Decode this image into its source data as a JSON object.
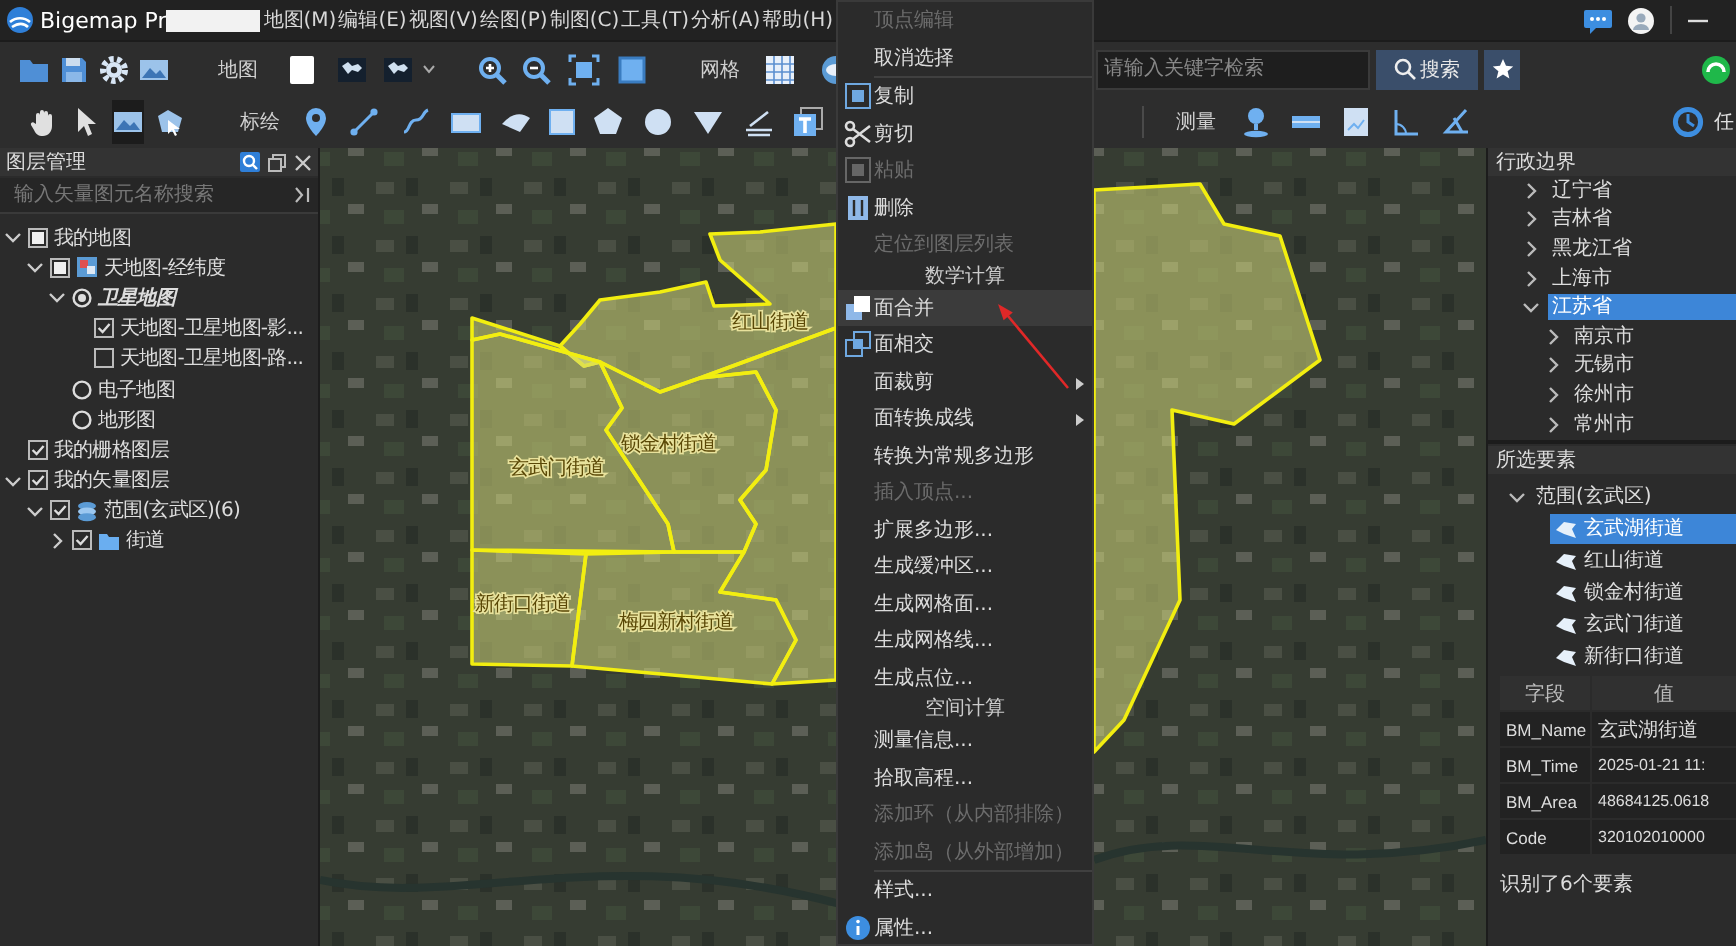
{
  "title_bar": {
    "app_name": "Bigemap Pr",
    "menus": [
      "地图(M)",
      "编辑(E)",
      "视图(V)",
      "绘图(P)",
      "制图(C)",
      "工具(T)",
      "分析(A)",
      "帮助(H)"
    ]
  },
  "toolbar": {
    "map_label": "地图",
    "grid_label": "网格",
    "search": {
      "placeholder": "请输入关键字检索"
    },
    "search_button": "搜索",
    "plot_label": "标绘",
    "measure_label": "测量",
    "task_label": "任"
  },
  "layer_panel": {
    "title": "图层管理",
    "search": {
      "placeholder": "输入矢量图元名称搜索"
    },
    "tree": [
      {
        "kind": "checkbox",
        "label": "我的地图",
        "checked": false,
        "indeterminate": true,
        "expanded": true,
        "children": [
          {
            "kind": "basemap",
            "label": "天地图-经纬度",
            "checked": false,
            "indeterminate": true,
            "expanded": true,
            "children": [
              {
                "kind": "radio",
                "label": "卫星地图",
                "selected": true,
                "expanded": true,
                "children": [
                  {
                    "kind": "checkbox",
                    "label": "天地图-卫星地图-影...",
                    "checked": true,
                    "indeterminate": false
                  },
                  {
                    "kind": "checkbox",
                    "label": "天地图-卫星地图-路...",
                    "checked": false,
                    "indeterminate": false
                  }
                ]
              },
              {
                "kind": "radio",
                "label": "电子地图",
                "selected": false
              },
              {
                "kind": "radio",
                "label": "地形图",
                "selected": false
              }
            ]
          }
        ]
      },
      {
        "kind": "checkbox",
        "label": "我的栅格图层",
        "checked": true,
        "indeterminate": false
      },
      {
        "kind": "checkbox",
        "label": "我的矢量图层",
        "checked": true,
        "indeterminate": false,
        "expanded": true,
        "children": [
          {
            "kind": "vector",
            "label": "范围(玄武区)(6)",
            "checked": true,
            "indeterminate": false,
            "expanded": true,
            "children": [
              {
                "kind": "folder",
                "label": "街道",
                "checked": true,
                "indeterminate": false,
                "expanded": false
              }
            ]
          }
        ]
      }
    ]
  },
  "map": {
    "areas": [
      {
        "label": "红山街道"
      },
      {
        "label": "锁金村街道"
      },
      {
        "label": "玄武门街道"
      },
      {
        "label": "新街口街道"
      },
      {
        "label": "梅园新村街道"
      }
    ]
  },
  "context_menu": {
    "items": [
      {
        "kind": "item",
        "label": "顶点编辑",
        "disabled": true,
        "selected": false,
        "submenu": false
      },
      {
        "kind": "item",
        "label": "取消选择",
        "disabled": false,
        "selected": false,
        "submenu": false
      },
      {
        "kind": "separator"
      },
      {
        "kind": "item",
        "label": "复制",
        "disabled": false,
        "selected": false,
        "submenu": false
      },
      {
        "kind": "item",
        "label": "剪切",
        "disabled": false,
        "selected": false,
        "submenu": false
      },
      {
        "kind": "item",
        "label": "粘贴",
        "disabled": true,
        "selected": false,
        "submenu": false
      },
      {
        "kind": "item",
        "label": "删除",
        "disabled": false,
        "selected": false,
        "submenu": false
      },
      {
        "kind": "item",
        "label": "定位到图层列表",
        "disabled": true,
        "selected": false,
        "submenu": false
      },
      {
        "kind": "header",
        "label": "数学计算"
      },
      {
        "kind": "item",
        "label": "面合并",
        "disabled": false,
        "selected": true,
        "submenu": false
      },
      {
        "kind": "item",
        "label": "面相交",
        "disabled": false,
        "selected": false,
        "submenu": false
      },
      {
        "kind": "item",
        "label": "面裁剪",
        "disabled": false,
        "selected": false,
        "submenu": true
      },
      {
        "kind": "item",
        "label": "面转换成线",
        "disabled": false,
        "selected": false,
        "submenu": true
      },
      {
        "kind": "item",
        "label": "转换为常规多边形",
        "disabled": false,
        "selected": false,
        "submenu": false
      },
      {
        "kind": "item",
        "label": "插入顶点...",
        "disabled": true,
        "selected": false,
        "submenu": false
      },
      {
        "kind": "item",
        "label": "扩展多边形...",
        "disabled": false,
        "selected": false,
        "submenu": false
      },
      {
        "kind": "item",
        "label": "生成缓冲区...",
        "disabled": false,
        "selected": false,
        "submenu": false
      },
      {
        "kind": "item",
        "label": "生成网格面...",
        "disabled": false,
        "selected": false,
        "submenu": false
      },
      {
        "kind": "item",
        "label": "生成网格线...",
        "disabled": false,
        "selected": false,
        "submenu": false
      },
      {
        "kind": "item",
        "label": "生成点位...",
        "disabled": false,
        "selected": false,
        "submenu": false
      },
      {
        "kind": "header",
        "label": "空间计算"
      },
      {
        "kind": "item",
        "label": "测量信息...",
        "disabled": false,
        "selected": false,
        "submenu": false
      },
      {
        "kind": "item",
        "label": "拾取高程...",
        "disabled": false,
        "selected": false,
        "submenu": false
      },
      {
        "kind": "item",
        "label": "添加环（从内部排除）",
        "disabled": true,
        "selected": false,
        "submenu": false
      },
      {
        "kind": "item",
        "label": "添加岛（从外部增加）",
        "disabled": true,
        "selected": false,
        "submenu": false
      },
      {
        "kind": "separator"
      },
      {
        "kind": "item",
        "label": "样式...",
        "disabled": false,
        "selected": false,
        "submenu": false
      },
      {
        "kind": "item",
        "label": "属性...",
        "disabled": false,
        "selected": false,
        "submenu": false
      }
    ]
  },
  "admin_panel": {
    "title": "行政边界",
    "tree": [
      {
        "label": "辽宁省",
        "expanded": false,
        "selected": false
      },
      {
        "label": "吉林省",
        "expanded": false,
        "selected": false
      },
      {
        "label": "黑龙江省",
        "expanded": false,
        "selected": false
      },
      {
        "label": "上海市",
        "expanded": false,
        "selected": false
      },
      {
        "label": "江苏省",
        "expanded": true,
        "selected": true,
        "children": [
          {
            "label": "南京市",
            "expanded": false,
            "selected": false
          },
          {
            "label": "无锡市",
            "expanded": false,
            "selected": false
          },
          {
            "label": "徐州市",
            "expanded": false,
            "selected": false
          },
          {
            "label": "常州市",
            "expanded": false,
            "selected": false
          }
        ]
      }
    ]
  },
  "features_panel": {
    "title": "所选要素",
    "group": {
      "label": "范围(玄武区)",
      "expanded": true
    },
    "items": [
      {
        "label": "玄武湖街道",
        "selected": true
      },
      {
        "label": "红山街道",
        "selected": false
      },
      {
        "label": "锁金村街道",
        "selected": false
      },
      {
        "label": "玄武门街道",
        "selected": false
      },
      {
        "label": "新街口街道",
        "selected": false
      }
    ]
  },
  "attribute_table": {
    "columns": [
      "字段",
      "值"
    ],
    "rows": [
      [
        "BM_Name",
        "玄武湖街道"
      ],
      [
        "BM_Time",
        "2025-01-21 11:"
      ],
      [
        "BM_Area",
        "48684125.0618"
      ],
      [
        "Code",
        "320102010000"
      ]
    ]
  },
  "status": "识别了6个要素"
}
